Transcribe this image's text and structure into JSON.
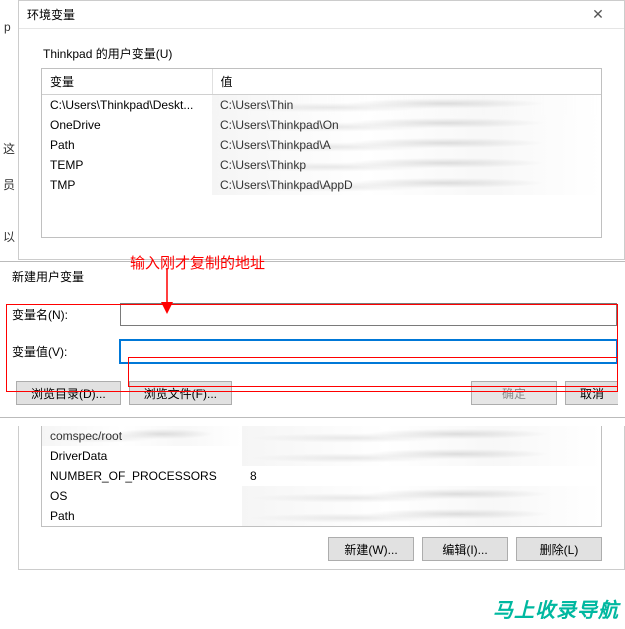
{
  "dialog": {
    "title": "环境变量"
  },
  "user_vars": {
    "group_label": "Thinkpad 的用户变量(U)",
    "headers": {
      "var": "变量",
      "val": "值"
    },
    "rows": [
      {
        "var": "C:\\Users\\Thinkpad\\Deskt...",
        "val": "C:\\Users\\Thin"
      },
      {
        "var": "OneDrive",
        "val": "C:\\Users\\Thinkpad\\On"
      },
      {
        "var": "Path",
        "val": "C:\\Users\\Thinkpad\\A"
      },
      {
        "var": "TEMP",
        "val": "C:\\Users\\Thinkp"
      },
      {
        "var": "TMP",
        "val": "C:\\Users\\Thinkpad\\AppD"
      }
    ]
  },
  "new_var_dialog": {
    "title": "新建用户变量",
    "name_label": "变量名(N):",
    "value_label": "变量值(V):",
    "name_value": "",
    "value_value": "",
    "browse_dir": "浏览目录(D)...",
    "browse_file": "浏览文件(F)...",
    "ok": "确定",
    "cancel": "取消"
  },
  "system_vars": {
    "rows": [
      {
        "var": "comspec/root",
        "val": ""
      },
      {
        "var": "DriverData",
        "val": ""
      },
      {
        "var": "NUMBER_OF_PROCESSORS",
        "val": "8"
      },
      {
        "var": "OS",
        "val": ""
      },
      {
        "var": "Path",
        "val": ""
      }
    ],
    "new_btn": "新建(W)...",
    "edit_btn": "编辑(I)...",
    "delete_btn": "删除(L)"
  },
  "annotation": {
    "text": "输入刚才复制的地址"
  },
  "bg_fragments": {
    "a": "p",
    "b": "这",
    "c": "员",
    "d": "以"
  },
  "watermark": "马上收录导航"
}
